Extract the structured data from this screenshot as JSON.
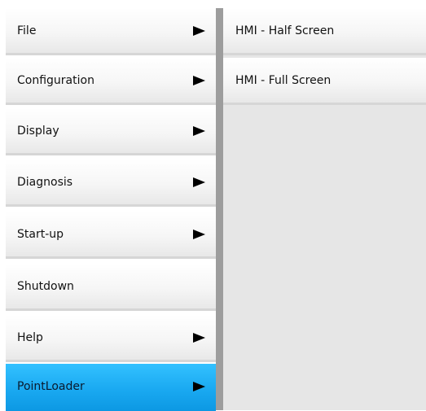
{
  "menu": {
    "items": [
      {
        "label": "File",
        "has_submenu": true
      },
      {
        "label": "Configuration",
        "has_submenu": true
      },
      {
        "label": "Display",
        "has_submenu": true
      },
      {
        "label": "Diagnosis",
        "has_submenu": true
      },
      {
        "label": "Start-up",
        "has_submenu": true
      },
      {
        "label": "Shutdown",
        "has_submenu": false
      },
      {
        "label": "Help",
        "has_submenu": true
      },
      {
        "label": "PointLoader",
        "has_submenu": true,
        "selected": true
      }
    ]
  },
  "submenu": {
    "items": [
      {
        "label": "HMI - Half Screen"
      },
      {
        "label": "HMI - Full Screen"
      }
    ]
  },
  "colors": {
    "selected_item": "#1aa9f1",
    "item_background": "#f6f6f6",
    "divider": "#9d9d9d",
    "panel_background": "#e6e6e6"
  }
}
